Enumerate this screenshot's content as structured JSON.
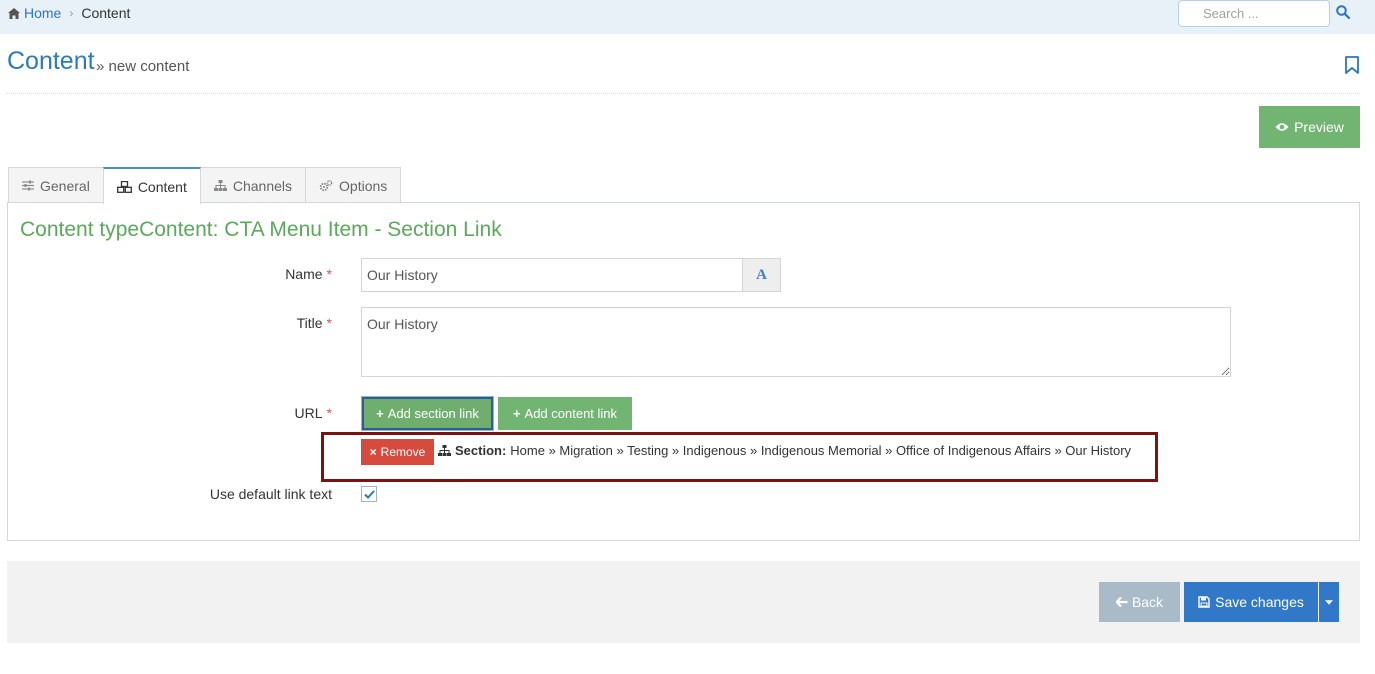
{
  "breadcrumb": {
    "home_label": "Home",
    "current_label": "Content"
  },
  "search": {
    "placeholder": "Search ..."
  },
  "page": {
    "title": "Content",
    "subtitle": "» new content"
  },
  "toolbar": {
    "preview_label": "Preview"
  },
  "tabs": [
    {
      "label": "General",
      "icon": "sliders-icon",
      "active": false
    },
    {
      "label": "Content",
      "icon": "cubes-icon",
      "active": true
    },
    {
      "label": "Channels",
      "icon": "sitemap-icon",
      "active": false
    },
    {
      "label": "Options",
      "icon": "gears-icon",
      "active": false
    }
  ],
  "form": {
    "content_type_heading": "Content typeContent: CTA Menu Item - Section Link",
    "name_label": "Name",
    "name_value": "Our History",
    "name_addon_icon": "text-icon",
    "title_label": "Title",
    "title_value": "Our History",
    "url_label": "URL",
    "required_marker": "*",
    "add_section_link_label": "Add section link",
    "add_content_link_label": "Add content link",
    "remove_label": "Remove",
    "section_prefix": "Section:",
    "section_path": "Home » Migration » Testing » Indigenous » Indigenous Memorial » Office of Indigenous Affairs » Our History",
    "use_default_link_text_label": "Use default link text",
    "use_default_link_text_checked": true
  },
  "footer": {
    "back_label": "Back",
    "save_label": "Save changes"
  },
  "colors": {
    "accent_blue": "#2a7ac0",
    "success_green": "#72b572",
    "danger_red": "#d74b3f",
    "highlight_border": "#7a1212",
    "primary_blue": "#3278c8",
    "back_gray": "#a9bac8"
  }
}
